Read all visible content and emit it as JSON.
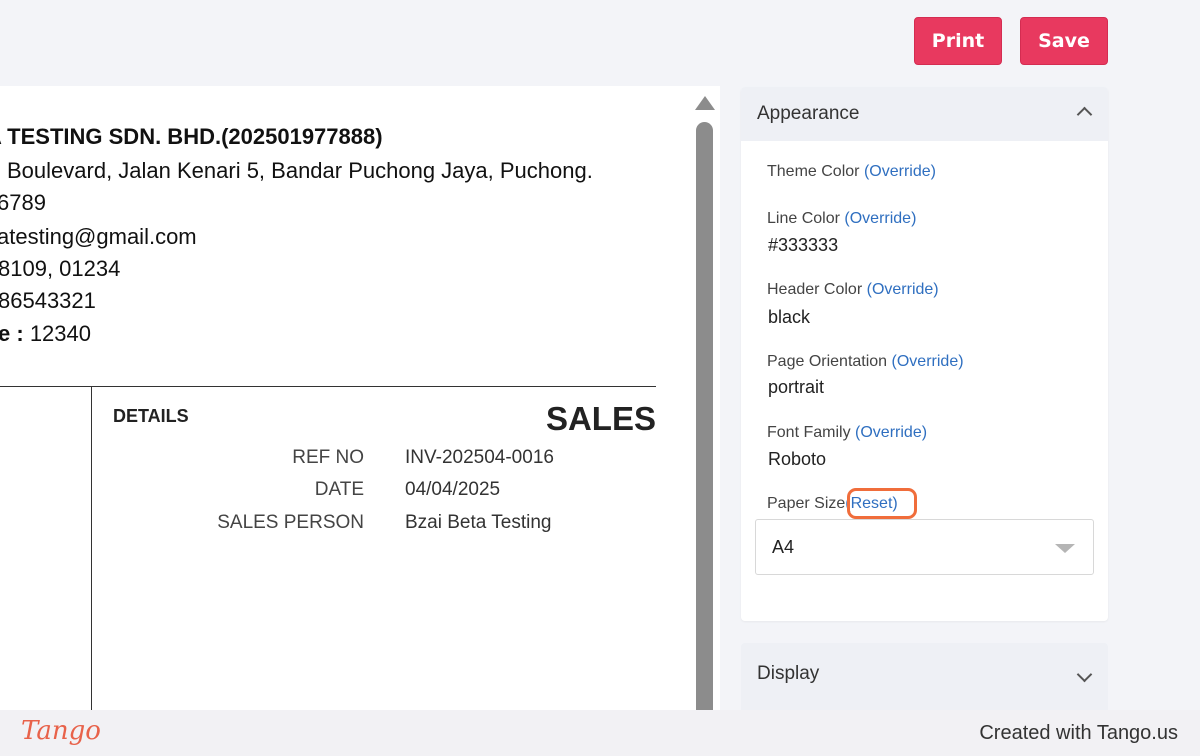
{
  "toolbar": {
    "print_label": "Print",
    "save_label": "Save"
  },
  "document": {
    "company": "A TESTING SDN. BHD.(202501977888)",
    "address": "l Boulevard, Jalan Kenari 5, Bandar Puchong Jaya, Puchong.",
    "phone": "6789",
    "email": "atesting@gmail.com",
    "line4": "8109, 01234",
    "line5": "86543321",
    "code_label": "e :",
    "code_value": "12340",
    "details_title": "DETAILS",
    "doc_type": "SALES",
    "fields": [
      {
        "label": "REF NO",
        "value": "INV-202504-0016"
      },
      {
        "label": "DATE",
        "value": "04/04/2025"
      },
      {
        "label": "SALES PERSON",
        "value": "Bzai Beta Testing"
      }
    ]
  },
  "appearance": {
    "title": "Appearance",
    "theme_color": {
      "label": "Theme Color",
      "link": "(Override)"
    },
    "line_color": {
      "label": "Line Color",
      "link": "(Override)",
      "value": "#333333"
    },
    "header_color": {
      "label": "Header Color",
      "link": "(Override)",
      "value": "black"
    },
    "page_orientation": {
      "label": "Page Orientation",
      "link": "(Override)",
      "value": "portrait"
    },
    "font_family": {
      "label": "Font Family",
      "link": "(Override)",
      "value": "Roboto"
    },
    "paper_size": {
      "label": "Paper Size",
      "link": "(Reset)",
      "value": "A4"
    }
  },
  "display": {
    "title": "Display"
  },
  "footer": {
    "logo_text": "Tango",
    "credit": "Created with Tango.us"
  },
  "colors": {
    "accent": "#e8395f",
    "link": "#2f6fc0",
    "highlight": "#f06d3b"
  }
}
